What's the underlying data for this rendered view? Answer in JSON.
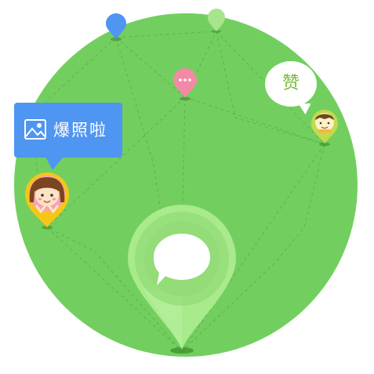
{
  "callout": {
    "label": "爆照啦",
    "icon": "image-icon",
    "color": "#4f95f2"
  },
  "like_bubble": {
    "label": "赞"
  },
  "pins": [
    {
      "name": "blue-pin",
      "color": "#4f95f2"
    },
    {
      "name": "light-green-pin",
      "color": "#a6e58d"
    },
    {
      "name": "pink-pin",
      "color": "#f28aa5",
      "icon": "ellipsis-icon"
    },
    {
      "name": "yellow-avatar-pin",
      "color": "#f5c518",
      "icon": "girl-avatar-icon"
    },
    {
      "name": "olive-avatar-pin",
      "color": "#c3d94e",
      "icon": "boy-avatar-icon"
    },
    {
      "name": "main-chat-pin",
      "color": "#a8ea8c",
      "icon": "chat-bubble-icon"
    }
  ],
  "colors": {
    "globe": "#72cf5f",
    "dashed_lines": "#5fb84b"
  }
}
